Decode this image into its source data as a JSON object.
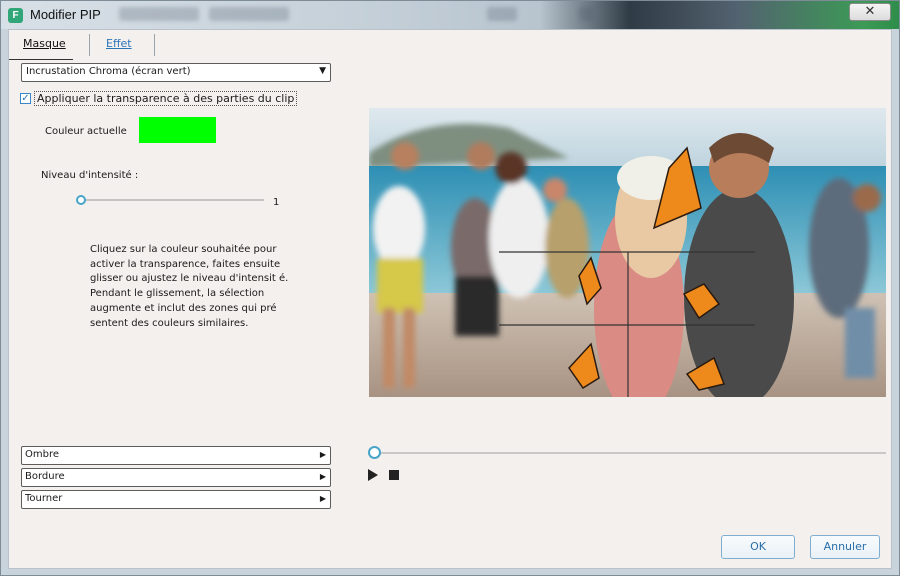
{
  "window": {
    "title": "Modifier PIP",
    "app_icon_letter": "F",
    "close_glyph": "✕"
  },
  "tabs": [
    {
      "label": "Masque"
    },
    {
      "label": "Effet"
    }
  ],
  "mask_type": {
    "selected": "Incrustation Chroma (écran vert)"
  },
  "transparency": {
    "checked": true,
    "label": "Appliquer la transparence à des parties du clip"
  },
  "current_color": {
    "label": "Couleur actuelle",
    "color": "#00ff00"
  },
  "intensity": {
    "label": "Niveau d'intensité :",
    "value": "1",
    "level": 0
  },
  "help_text": "Cliquez sur la couleur souhaitée pour activer la transparence, faites ensuite glisser ou ajustez le niveau d'intensit é. Pendant le glissement, la sélection augmente et inclut des zones qui pré sentent des couleurs similaires.",
  "sections": [
    {
      "label": "Ombre"
    },
    {
      "label": "Bordure"
    },
    {
      "label": "Tourner"
    }
  ],
  "playback": {
    "position": 0
  },
  "buttons": {
    "ok": "OK",
    "cancel": "Annuler"
  },
  "icons": {
    "app": "filmora-icon",
    "dropdown": "dropdown-arrow-icon",
    "checkbox": "checkbox-checked-icon",
    "expand": "expand-triangle-icon",
    "play": "play-icon",
    "stop": "stop-icon"
  }
}
